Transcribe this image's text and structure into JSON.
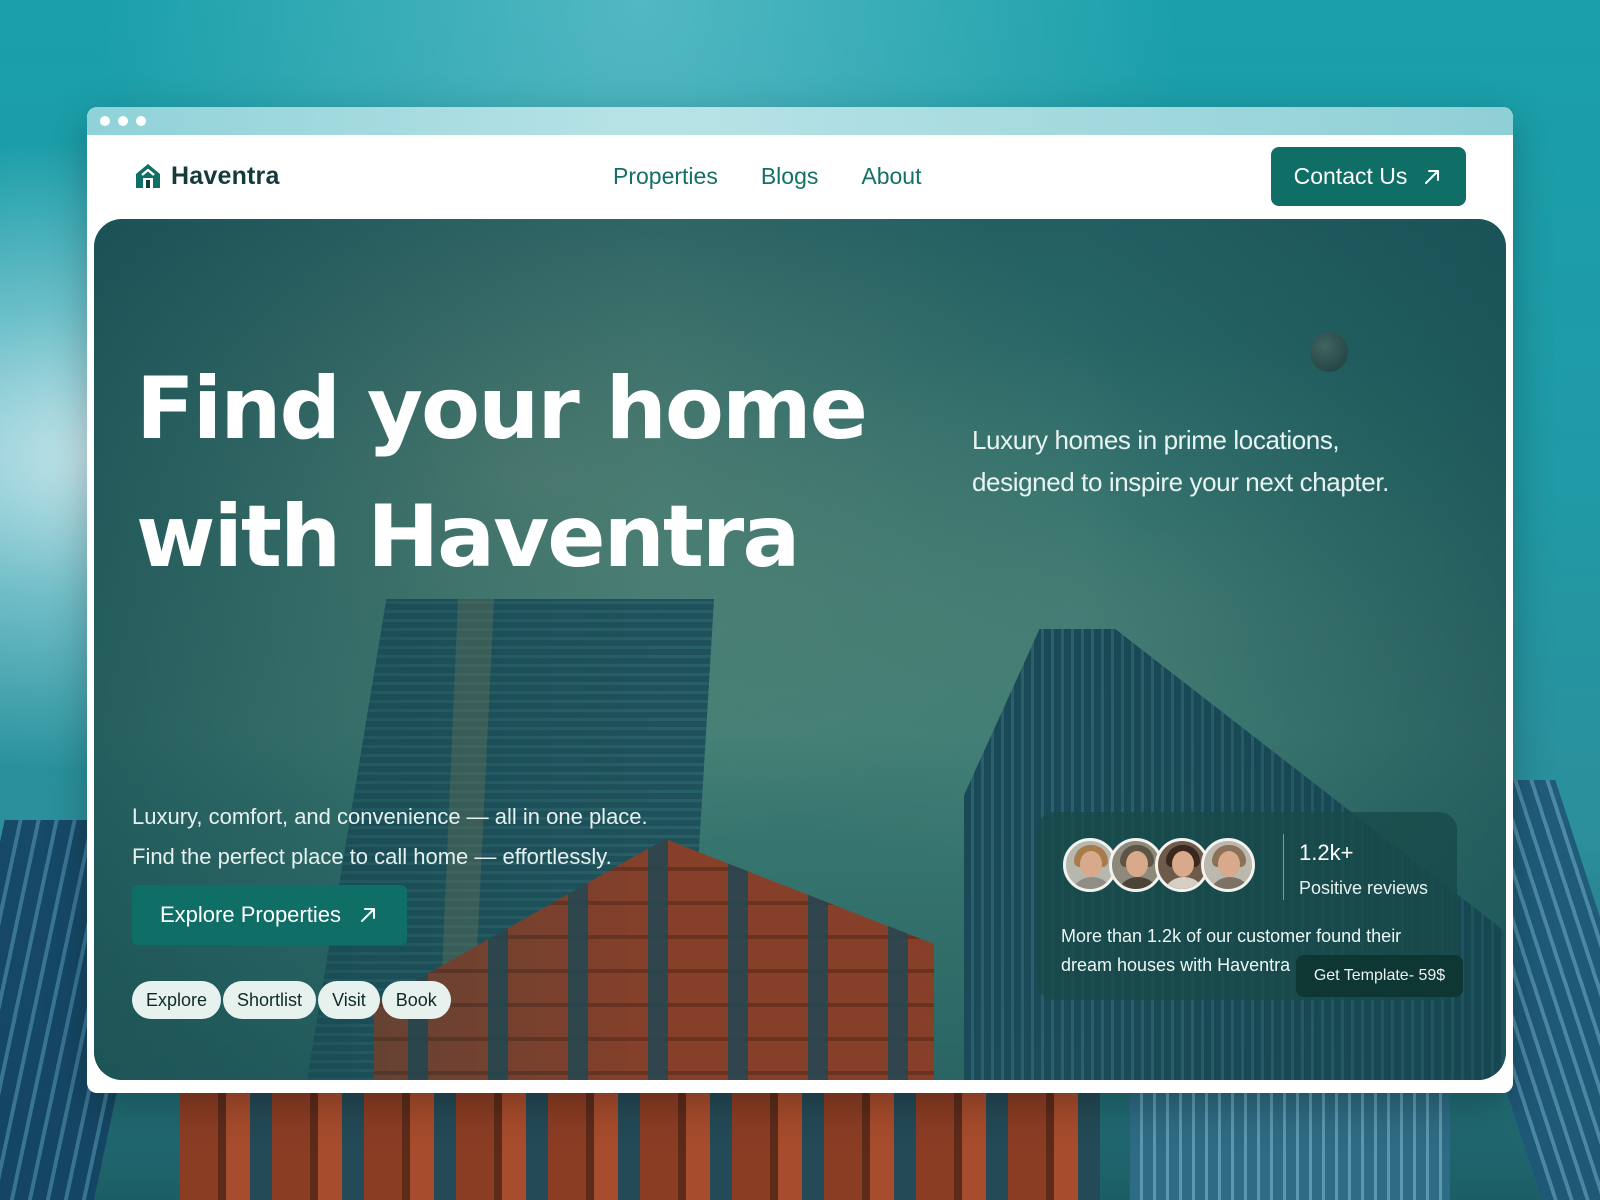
{
  "brand": {
    "name": "Haventra",
    "logo_icon": "house-logo-icon"
  },
  "nav": {
    "links": [
      {
        "label": "Properties"
      },
      {
        "label": "Blogs"
      },
      {
        "label": "About"
      }
    ],
    "contact_label": "Contact Us",
    "contact_icon": "arrow-up-right-icon"
  },
  "hero": {
    "title_line1": "Find your home",
    "title_line2": "with Haventra",
    "description_line1": "Luxury homes in prime locations,",
    "description_line2": "designed to inspire your next chapter.",
    "subtitle_line1": "Luxury, comfort, and convenience — all in one place.",
    "subtitle_line2": "Find the perfect place to call home — effortlessly.",
    "cta_label": "Explore Properties",
    "steps": [
      "Explore",
      "Shortlist",
      "Visit",
      "Book"
    ]
  },
  "reviews": {
    "count": "1.2k+",
    "label": "Positive reviews",
    "text": "More than 1.2k of our customer found their dream houses  with Haventra",
    "avatars": [
      "customer-avatar-1",
      "customer-avatar-2",
      "customer-avatar-3",
      "customer-avatar-4"
    ]
  },
  "template_badge": "Get Template- 59$",
  "colors": {
    "accent": "#0f6e66",
    "brand_text": "#143b3b",
    "nav_text": "#147066",
    "chip_bg": "#e7f1ee",
    "badge_bg": "#0e3632"
  }
}
